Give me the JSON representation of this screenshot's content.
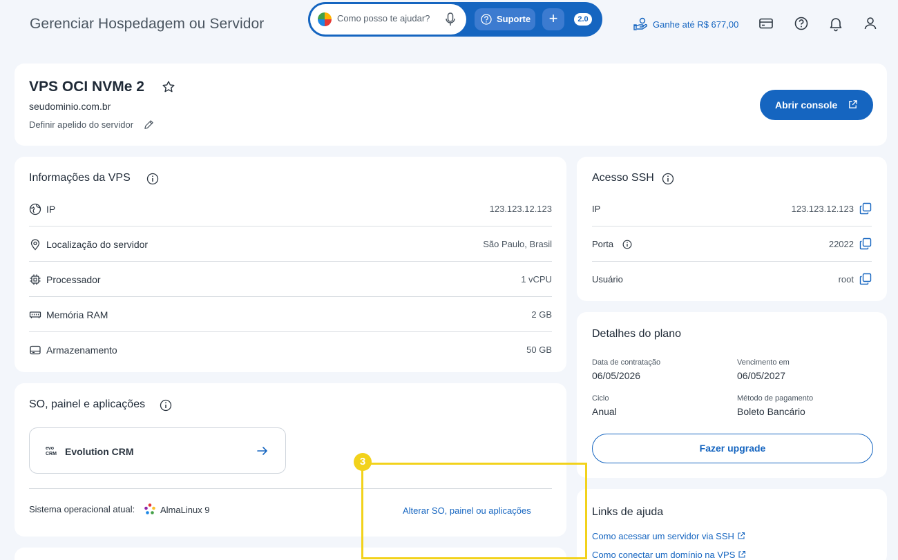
{
  "header": {
    "title": "Gerenciar Hospedagem ou Servidor",
    "assistant_placeholder": "Como posso te ajudar?",
    "support_label": "Suporte",
    "plus_label": "+",
    "version_badge": "2.0",
    "earn_label": "Ganhe até R$ 677,00"
  },
  "server": {
    "name": "VPS OCI NVMe 2",
    "domain": "seudominio.com.br",
    "nickname_label": "Definir apelido do servidor",
    "console_label": "Abrir console"
  },
  "vps_info": {
    "title": "Informações da VPS",
    "rows": [
      {
        "label": "IP",
        "value": "123.123.12.123",
        "icon": "globe-icon"
      },
      {
        "label": "Localização do servidor",
        "value": "São Paulo, Brasil",
        "icon": "location-pin-icon"
      },
      {
        "label": "Processador",
        "value": "1 vCPU",
        "icon": "cpu-icon"
      },
      {
        "label": "Memória RAM",
        "value": "2 GB",
        "icon": "ram-icon"
      },
      {
        "label": "Armazenamento",
        "value": "50 GB",
        "icon": "storage-icon"
      }
    ]
  },
  "ssh": {
    "title": "Acesso SSH",
    "rows": [
      {
        "label": "IP",
        "value": "123.123.12.123"
      },
      {
        "label": "Porta",
        "value": "22022"
      },
      {
        "label": "Usuário",
        "value": "root"
      }
    ]
  },
  "plan": {
    "title": "Detalhes do plano",
    "contract_label": "Data de contratação",
    "contract_value": "06/05/2026",
    "due_label": "Vencimento em",
    "due_value": "06/05/2027",
    "cycle_label": "Ciclo",
    "cycle_value": "Anual",
    "payment_label": "Método de pagamento",
    "payment_value": "Boleto Bancário",
    "upgrade_label": "Fazer upgrade"
  },
  "help": {
    "title": "Links de ajuda",
    "links": [
      "Como acessar um servidor via SSH",
      "Como conectar um domínio na VPS"
    ]
  },
  "os": {
    "title": "SO, painel e aplicações",
    "app_name": "Evolution CRM",
    "app_logo_text": "evo CRM",
    "current_label": "Sistema operacional atual:",
    "current_value": "AlmaLinux 9",
    "change_link": "Alterar SO, painel ou aplicações"
  },
  "annotation": {
    "step": "3",
    "color": "#f2d21b"
  },
  "colors": {
    "primary": "#1565c0",
    "background": "#f3f6fb"
  }
}
